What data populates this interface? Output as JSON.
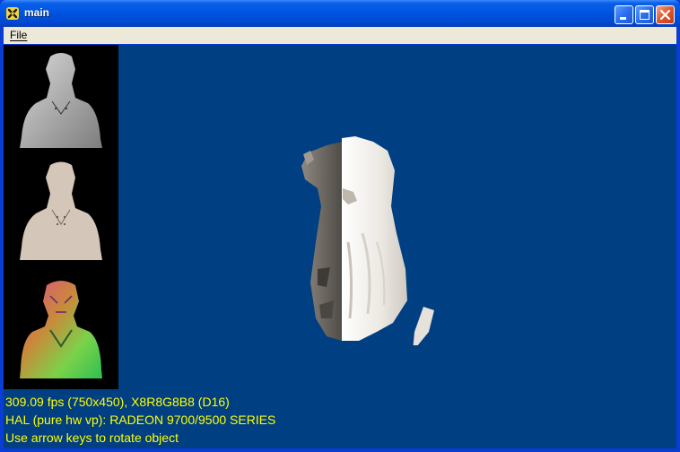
{
  "window": {
    "title": "main",
    "app_icon": "directx-icon",
    "buttons": [
      "minimize-icon",
      "maximize-icon",
      "close-icon"
    ]
  },
  "menu": {
    "items": [
      {
        "label": "File",
        "mnemonic": "F"
      }
    ]
  },
  "viewport": {
    "background": "#003f82",
    "thumbnails": [
      {
        "name": "grayscale-bust-thumbnail"
      },
      {
        "name": "tan-bust-thumbnail"
      },
      {
        "name": "normal-map-bust-thumbnail"
      }
    ],
    "model": "shaded-bust-model"
  },
  "status": {
    "line1": "309.09 fps (750x450), X8R8G8B8 (D16)",
    "line2": "HAL (pure hw vp): RADEON 9700/9500 SERIES",
    "line3": "Use arrow keys to rotate object",
    "color": "#ffff00"
  }
}
